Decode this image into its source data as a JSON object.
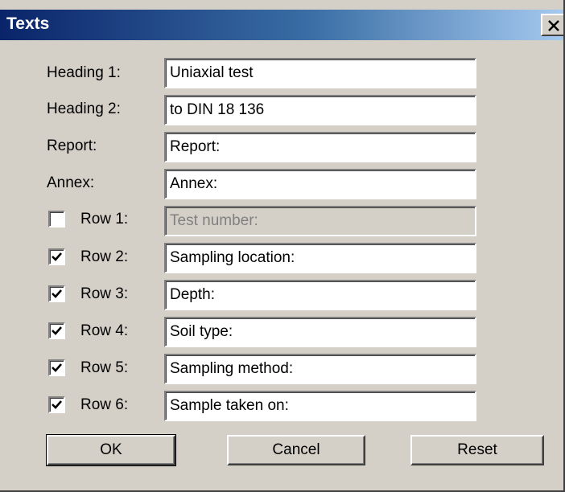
{
  "window": {
    "title": "Texts",
    "close_glyph": "×"
  },
  "fields": {
    "heading1": {
      "label": "Heading 1:",
      "value": "Uniaxial test"
    },
    "heading2": {
      "label": "Heading 2:",
      "value": "to DIN 18 136"
    },
    "report": {
      "label": "Report:",
      "value": "Report:"
    },
    "annex": {
      "label": "Annex:",
      "value": "Annex:"
    }
  },
  "rows": [
    {
      "label": "Row 1:",
      "value": "Test number:",
      "checked": false,
      "enabled": false
    },
    {
      "label": "Row 2:",
      "value": "Sampling location:",
      "checked": true,
      "enabled": true
    },
    {
      "label": "Row 3:",
      "value": "Depth:",
      "checked": true,
      "enabled": true
    },
    {
      "label": "Row 4:",
      "value": "Soil type:",
      "checked": true,
      "enabled": true
    },
    {
      "label": "Row 5:",
      "value": "Sampling method:",
      "checked": true,
      "enabled": true
    },
    {
      "label": "Row 6:",
      "value": "Sample taken on:",
      "checked": true,
      "enabled": true
    }
  ],
  "buttons": {
    "ok": "OK",
    "cancel": "Cancel",
    "reset": "Reset"
  }
}
